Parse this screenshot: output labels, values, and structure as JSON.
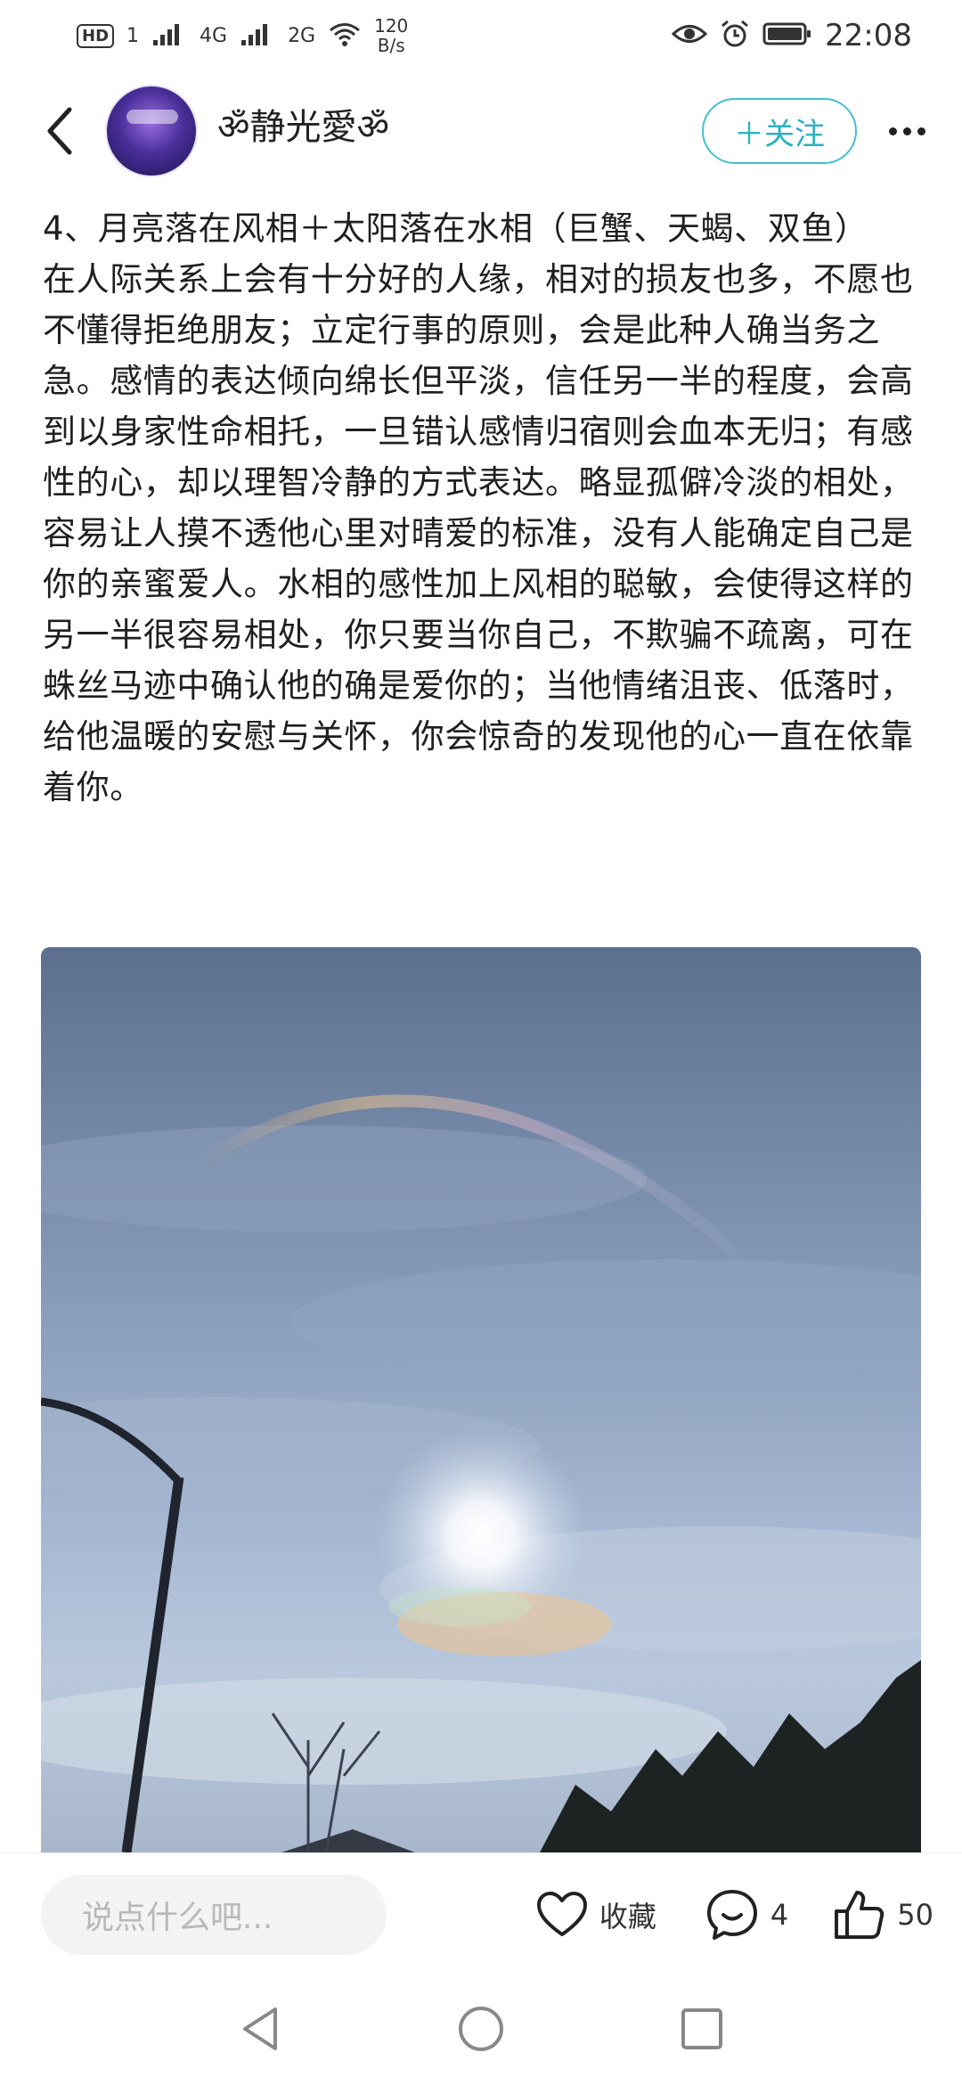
{
  "status_bar": {
    "hd": "HD",
    "sim1": "1",
    "net1": "4G",
    "net2": "2G",
    "speed_value": "120",
    "speed_unit": "B/s",
    "time": "22:08",
    "icons": [
      "eye-icon",
      "alarm-icon",
      "battery-icon",
      "wifi-icon",
      "signal-icon"
    ]
  },
  "header": {
    "username": "ॐ静光愛ॐ",
    "follow_label": "＋关注"
  },
  "article": {
    "heading": "4、月亮落在风相＋太阳落在水相（巨蟹、天蝎、双鱼）",
    "body": "在人际关系上会有十分好的人缘，相对的损友也多，不愿也不懂得拒绝朋友；立定行事的原则，会是此种人确当务之急。感情的表达倾向绵长但平淡，信任另一半的程度，会高到以身家性命相托，一旦错认感情归宿则会血本无归；有感性的心，却以理智冷静的方式表达。略显孤僻冷淡的相处，容易让人摸不透他心里对晴爱的标准，没有人能确定自己是你的亲蜜爱人。水相的感性加上风相的聪敏，会使得这样的另一半很容易相处，你只要当你自己，不欺骗不疏离，可在蛛丝马迹中确认他的确是爱你的；当他情绪沮丧、低落时，给他温暖的安慰与关怀，你会惊奇的发现他的心一直在依靠着你。"
  },
  "bottom_bar": {
    "comment_placeholder": "说点什么吧...",
    "favorite_label": "收藏",
    "comment_count": "4",
    "like_count": "50"
  },
  "colors": {
    "accent": "#2cb1c0",
    "follow_border": "#45c0cc",
    "text": "#1f1f1f",
    "placeholder": "#b8b8b8"
  }
}
